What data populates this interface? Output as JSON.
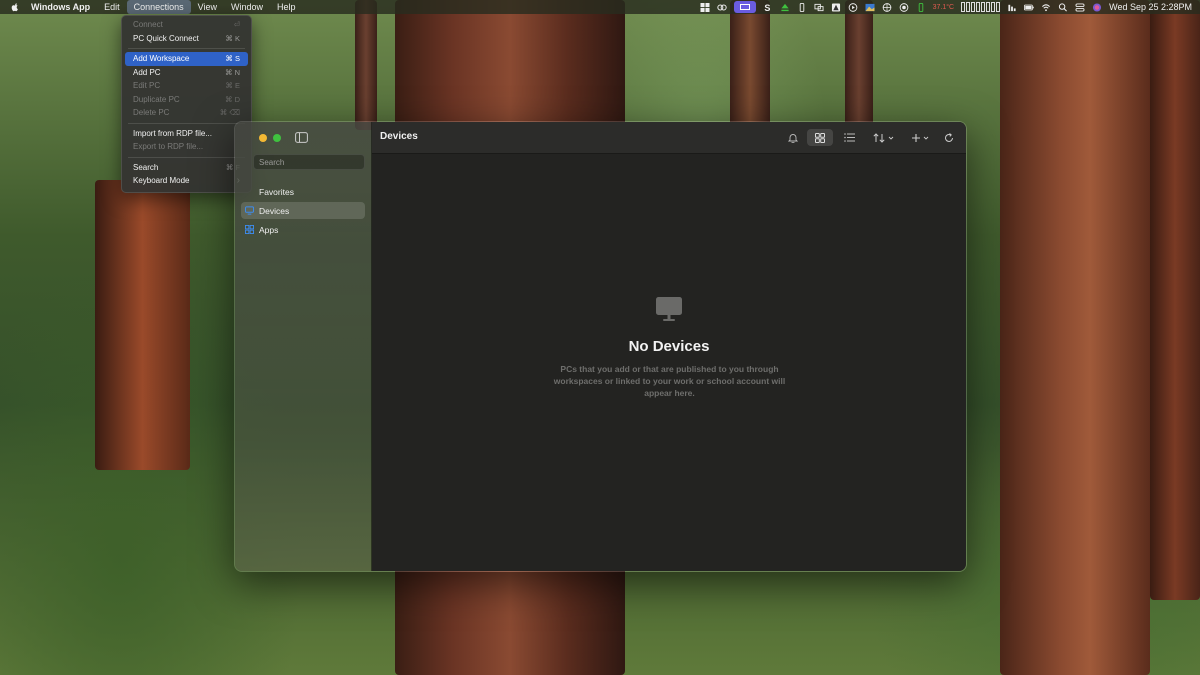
{
  "menubar": {
    "app_name": "Windows App",
    "items": [
      "Edit",
      "Connections",
      "View",
      "Window",
      "Help"
    ],
    "status": {
      "temp": "37.1°C",
      "date_time": "Wed Sep 25  2:28PM"
    }
  },
  "connections_menu": {
    "group1": [
      {
        "label": "Connect",
        "shortcut": "⏎",
        "disabled": true
      },
      {
        "label": "PC Quick Connect",
        "shortcut": "⌘ K",
        "disabled": false
      }
    ],
    "group2": [
      {
        "label": "Add Workspace",
        "shortcut": "⌘ S",
        "disabled": false
      },
      {
        "label": "Add PC",
        "shortcut": "⌘ N",
        "disabled": false
      },
      {
        "label": "Edit PC",
        "shortcut": "⌘ E",
        "disabled": true
      },
      {
        "label": "Duplicate PC",
        "shortcut": "⌘ D",
        "disabled": true
      },
      {
        "label": "Delete PC",
        "shortcut": "⌘ ⌫",
        "disabled": true
      }
    ],
    "group3": [
      {
        "label": "Import from RDP file...",
        "shortcut": "",
        "disabled": false
      },
      {
        "label": "Export to RDP file...",
        "shortcut": "",
        "disabled": true
      }
    ],
    "group4": [
      {
        "label": "Search",
        "shortcut": "⌘ F",
        "disabled": false
      },
      {
        "label": "Keyboard Mode",
        "shortcut": "›",
        "disabled": false
      }
    ]
  },
  "sidebar": {
    "search_placeholder": "Search",
    "items": [
      {
        "label": "Favorites"
      },
      {
        "label": "Devices"
      },
      {
        "label": "Apps"
      }
    ]
  },
  "main": {
    "title": "Devices",
    "empty_title": "No Devices",
    "empty_description": "PCs that you add or that are published to you through workspaces or linked to your work or school account will appear here."
  },
  "colors": {
    "menu_highlight": "#2f62c7",
    "window_bg": "#232321",
    "accent_blue": "#3d8cf0"
  }
}
